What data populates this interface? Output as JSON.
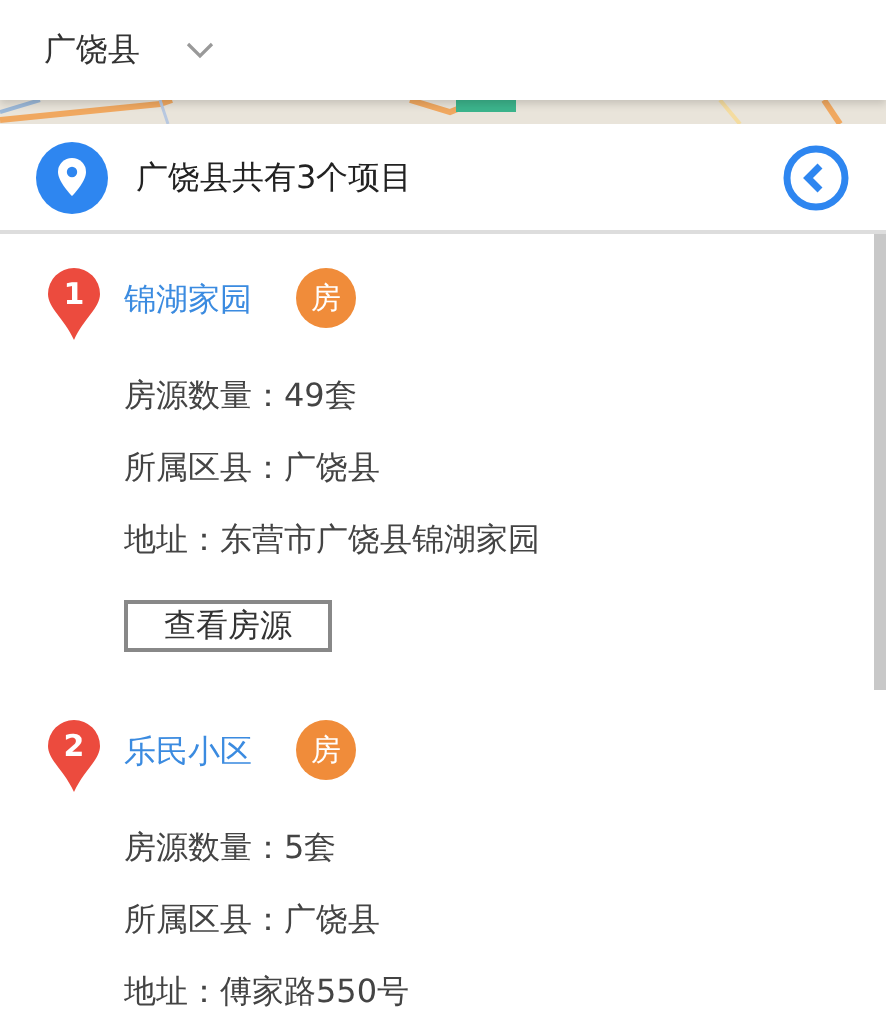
{
  "district_select": {
    "value": "广饶县"
  },
  "summary": {
    "text": "广饶县共有3个项目"
  },
  "projects": [
    {
      "number": "1",
      "name": "锦湖家园",
      "badge": "房",
      "lines": [
        "房源数量：49套",
        "所属区县：广饶县",
        "地址：东营市广饶县锦湖家园"
      ],
      "button": "查看房源"
    },
    {
      "number": "2",
      "name": "乐民小区",
      "badge": "房",
      "lines": [
        "房源数量：5套",
        "所属区县：广饶县",
        "地址：傅家路550号"
      ]
    }
  ]
}
